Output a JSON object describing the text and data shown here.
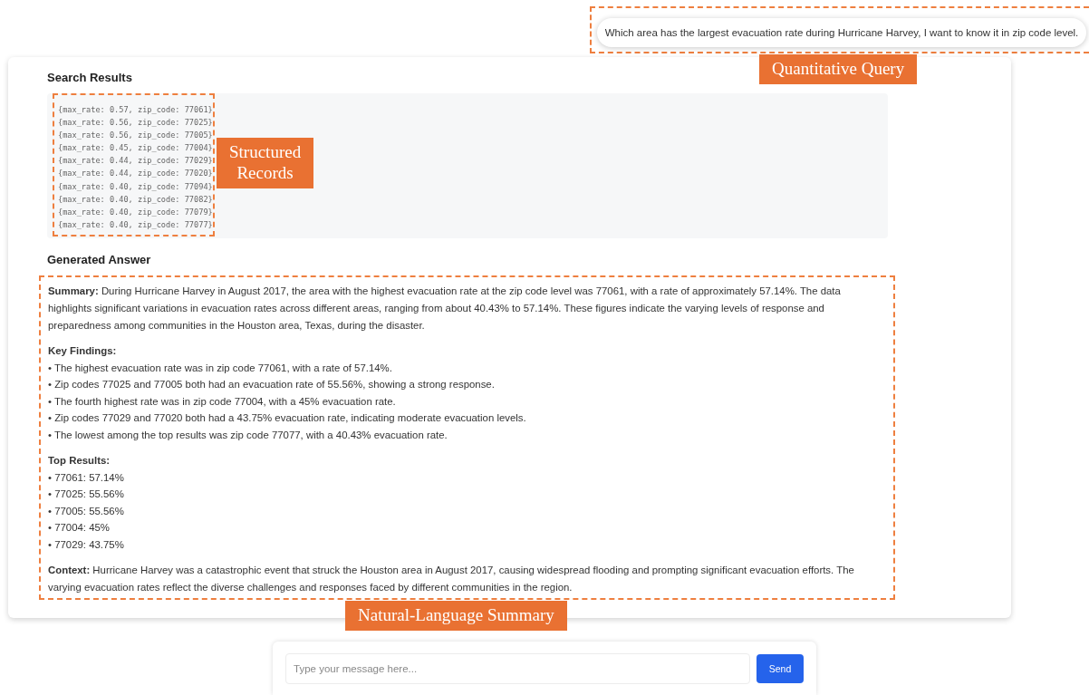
{
  "query": {
    "text": "Which area has the largest evacuation rate during Hurricane Harvey, I want to know it in zip code level.",
    "annotation": "Quantitative Query"
  },
  "search_results": {
    "title": "Search Results",
    "annotation": "Structured Records",
    "records": [
      "{max_rate: 0.57, zip_code: 77061}",
      "{max_rate: 0.56, zip_code: 77025}",
      "{max_rate: 0.56, zip_code: 77005}",
      "{max_rate: 0.45, zip_code: 77004}",
      "{max_rate: 0.44, zip_code: 77029}",
      "{max_rate: 0.44, zip_code: 77020}",
      "{max_rate: 0.40, zip_code: 77094}",
      "{max_rate: 0.40, zip_code: 77082}",
      "{max_rate: 0.40, zip_code: 77079}",
      "{max_rate: 0.40, zip_code: 77077}"
    ]
  },
  "generated_answer": {
    "title": "Generated Answer",
    "annotation": "Natural-Language Summary",
    "sections": [
      {
        "kind": "paragraph",
        "text": "**Summary:** During Hurricane Harvey in August 2017, the area with the highest evacuation rate at the zip code level was 77061, with a rate of approximately 57.14%. The data highlights significant variations in evacuation rates across different areas, ranging from about 40.43% to 57.14%. These figures indicate the varying levels of response and preparedness among communities in the Houston area, Texas, during the disaster."
      },
      {
        "kind": "list",
        "heading": "Key Findings:",
        "items": [
          "• The highest evacuation rate was in zip code 77061, with a rate of 57.14%.",
          "• Zip codes 77025 and 77005 both had an evacuation rate of 55.56%, showing a strong response.",
          "• The fourth highest rate was in zip code 77004, with a 45% evacuation rate.",
          "• Zip codes 77029 and 77020 both had a 43.75% evacuation rate, indicating moderate evacuation levels.",
          "• The lowest among the top results was zip code 77077, with a 40.43% evacuation rate."
        ]
      },
      {
        "kind": "list",
        "heading": "Top Results:",
        "items": [
          "• 77061: 57.14%",
          "• 77025: 55.56%",
          "• 77005: 55.56%",
          "• 77004: 45%",
          "• 77029: 43.75%"
        ]
      },
      {
        "kind": "paragraph",
        "text": "**Context:** Hurricane Harvey was a catastrophic event that struck the Houston area in August 2017, causing widespread flooding and prompting significant evacuation efforts. The varying evacuation rates reflect the diverse challenges and responses faced by different communities in the region."
      }
    ]
  },
  "composer": {
    "placeholder": "Type your message here...",
    "send_label": "Send"
  }
}
